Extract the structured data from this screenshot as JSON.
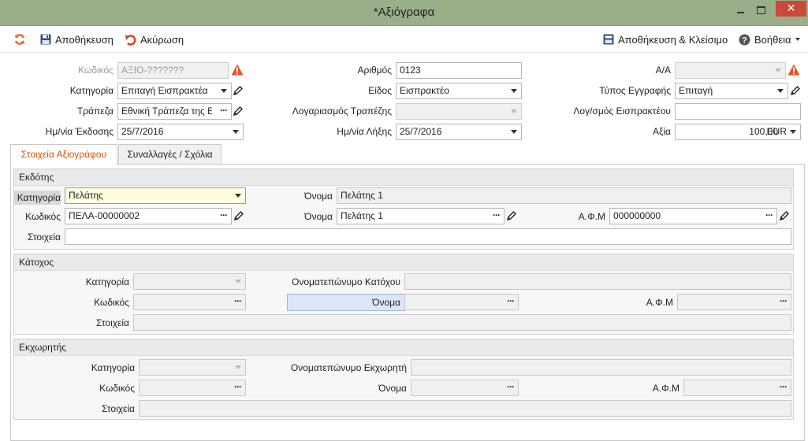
{
  "window": {
    "title": "*Αξιόγραφα",
    "close_glyph": "✕"
  },
  "toolbar": {
    "refresh_icon": "refresh-icon",
    "save_label": "Αποθήκευση",
    "cancel_label": "Ακύρωση",
    "save_close_label": "Αποθήκευση & Κλείσιμο",
    "help_label": "Βοήθεια"
  },
  "header": {
    "code": {
      "label": "Κωδικός",
      "placeholder": "ΑΞΙΟ-???????"
    },
    "category": {
      "label": "Κατηγορία",
      "value": "Επιταγή Εισπρακτέα"
    },
    "bank": {
      "label": "Τράπεζα",
      "value": "Εθνική Τράπεζα της Ε"
    },
    "issue_date": {
      "label": "Ημ/νία Έκδοσης",
      "value": "25/7/2016"
    },
    "number": {
      "label": "Αριθμός",
      "value": "0123"
    },
    "kind": {
      "label": "Είδος",
      "value": "Εισπρακτέο"
    },
    "bank_account": {
      "label": "Λογαριασμός Τραπέζης",
      "value": ""
    },
    "due_date": {
      "label": "Ημ/νία Λήξης",
      "value": "25/7/2016"
    },
    "aa": {
      "label": "Α/Α",
      "value": ""
    },
    "record_type": {
      "label": "Τύπος Εγγραφής",
      "value": "Επιταγή"
    },
    "collection_account": {
      "label": "Λογ/σμός Εισπρακτέου",
      "value": ""
    },
    "amount": {
      "label": "Αξία",
      "value": "100,00",
      "currency": "EUR"
    },
    "dots": "···"
  },
  "tabs": [
    {
      "label": "Στοιχεία Αξιογράφου",
      "active": true
    },
    {
      "label": "Συναλλαγές / Σχόλια",
      "active": false
    }
  ],
  "issuer": {
    "title": "Εκδότης",
    "category_label": "Κατηγορία",
    "category_value": "Πελάτης",
    "name_label": "Όνομα",
    "name_value": "Πελάτης 1",
    "code_label": "Κωδικός",
    "code_value": "ΠΕΛΑ-00000002",
    "name2_label": "Όνομα",
    "name2_value": "Πελάτης 1",
    "afm_label": "Α.Φ.Μ",
    "afm_value": "000000000",
    "details_label": "Στοιχεία",
    "details_value": ""
  },
  "holder": {
    "title": "Κάτοχος",
    "category_label": "Κατηγορία",
    "fullname_label": "Ονοματεπώνυμο Κατόχου",
    "code_label": "Κωδικός",
    "name_label": "Όνομα",
    "afm_label": "Α.Φ.Μ",
    "details_label": "Στοιχεία"
  },
  "assignor": {
    "title": "Εκχωρητής",
    "category_label": "Κατηγορία",
    "fullname_label": "Ονοματεπώνυμο Εκχωρητή",
    "code_label": "Κωδικός",
    "name_label": "Όνομα",
    "afm_label": "Α.Φ.Μ",
    "details_label": "Στοιχεία"
  },
  "colors": {
    "accent": "#d35400",
    "titlebar": "#9aae8a",
    "warning": "#e0542c",
    "close": "#c94a3a"
  }
}
